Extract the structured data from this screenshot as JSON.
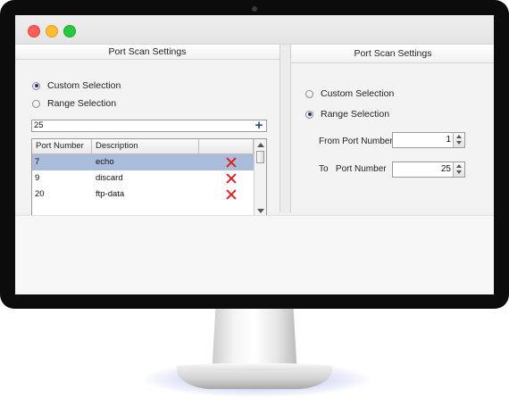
{
  "window": {
    "controls": [
      "close",
      "minimize",
      "zoom"
    ]
  },
  "left_panel": {
    "title": "Port Scan Settings",
    "radio_custom": "Custom Selection",
    "radio_range": "Range Selection",
    "selected_mode": "Custom Selection",
    "port_input_value": "25",
    "add_button_icon": "plus-icon",
    "table": {
      "columns": [
        "Port Number",
        "Description"
      ],
      "rows": [
        {
          "port": "7",
          "description": "echo",
          "selected": true
        },
        {
          "port": "9",
          "description": "discard",
          "selected": false
        },
        {
          "port": "20",
          "description": "ftp-data",
          "selected": false
        }
      ],
      "row_action_icon": "delete-x-icon"
    }
  },
  "right_panel": {
    "title": "Port Scan Settings",
    "radio_custom": "Custom Selection",
    "radio_range": "Range Selection",
    "selected_mode": "Range Selection",
    "from_label": "From Port Number",
    "from_value": "1",
    "to_label": "To   Port Number",
    "to_value": "25"
  },
  "colors": {
    "selected_row": "#a9bcd9",
    "delete_icon": "#e02020",
    "add_icon": "#2a4a86",
    "close": "#ff5f57",
    "minimize": "#febc2e",
    "zoom": "#28c840"
  }
}
